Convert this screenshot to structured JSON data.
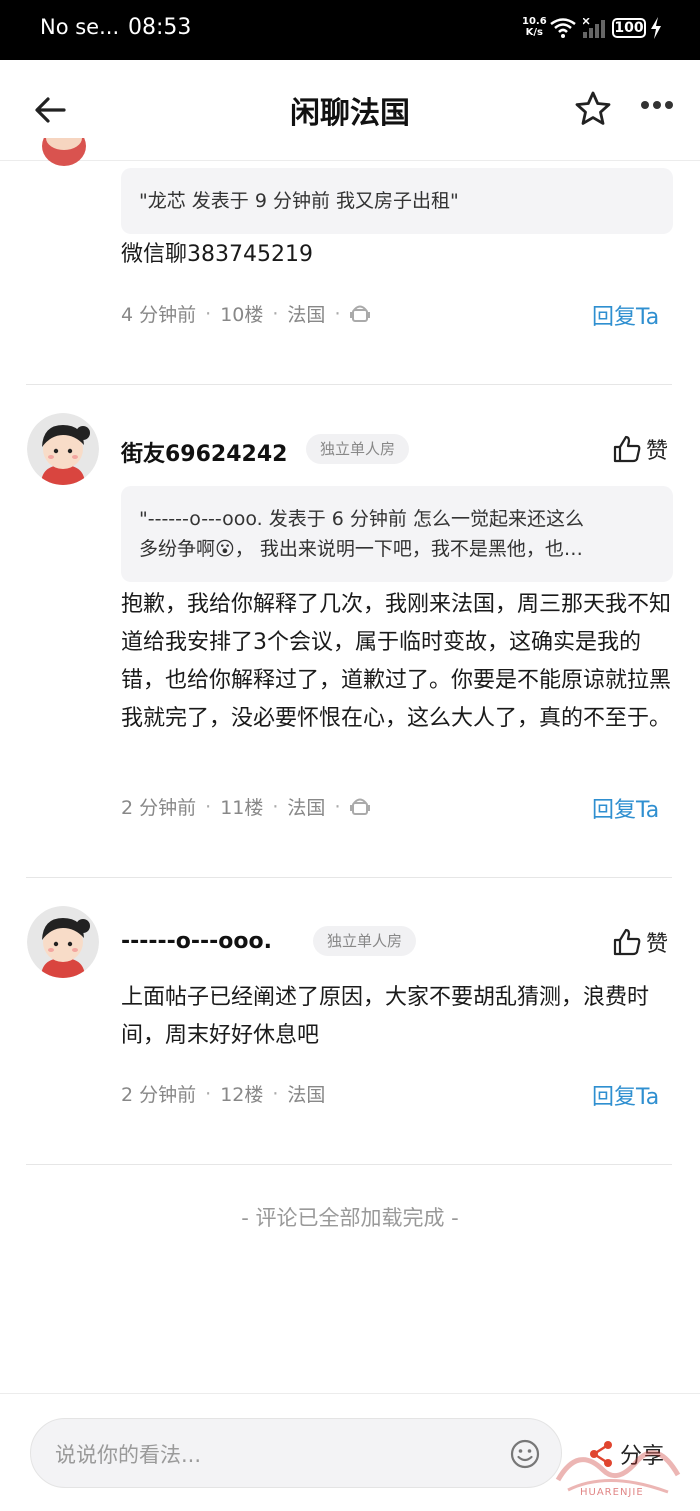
{
  "status_bar": {
    "carrier": "No se...",
    "time": "08:53",
    "net_speed": "10.6",
    "net_unit": "K/s",
    "battery": "100"
  },
  "nav": {
    "title": "闲聊法国"
  },
  "comments": [
    {
      "quote": "\"龙芯 发表于 9 分钟前 我又房子出租\"",
      "body": "微信聊383745219",
      "time": "4 分钟前",
      "floor": "10楼",
      "location": "法国",
      "reply": "回复Ta"
    },
    {
      "username": "街友69624242",
      "tag": "独立单人房",
      "like": "赞",
      "quote_line1": "\"------o---ooo. 发表于 6 分钟前 怎么一觉起来还这么",
      "quote_line2": "多纷争啊😮，  我出来说明一下吧，我不是黑他，也…",
      "body": "抱歉，我给你解释了几次，我刚来法国，周三那天我不知道给我安排了3个会议，属于临时变故，这确实是我的错，也给你解释过了，道歉过了。你要是不能原谅就拉黑我就完了，没必要怀恨在心，这么大人了，真的不至于。",
      "time": "2 分钟前",
      "floor": "11楼",
      "location": "法国",
      "reply": "回复Ta"
    },
    {
      "username": "------o---ooo.",
      "tag": "独立单人房",
      "like": "赞",
      "body": "上面帖子已经阐述了原因，大家不要胡乱猜测，浪费时间，周末好好休息吧",
      "time": "2 分钟前",
      "floor": "12楼",
      "location": "法国",
      "reply": "回复Ta"
    }
  ],
  "end_text": "- 评论已全部加载完成 -",
  "bottom_bar": {
    "input_placeholder": "说说你的看法...",
    "share_label": "分享"
  },
  "watermark": {
    "text": "HUARENJIE"
  }
}
